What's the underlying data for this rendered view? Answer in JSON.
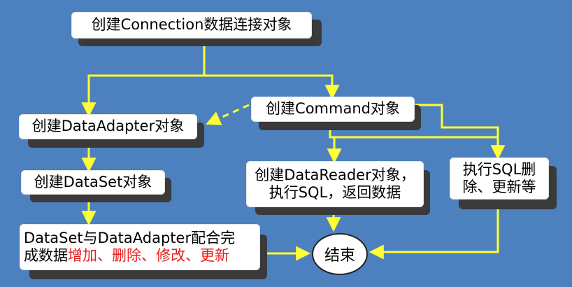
{
  "nodes": {
    "create_connection": "创建Connection数据连接对象",
    "create_command": "创建Command对象",
    "create_dataadapter": "创建DataAdapter对象",
    "create_dataset": "创建DataSet对象",
    "create_datareader_line1": "创建DataReader对象，",
    "create_datareader_line2": "执行SQL，返回数据",
    "exec_sql_line1": "执行SQL删",
    "exec_sql_line2": "除、更新等",
    "dataset_combine_line1": "DataSet与DataAdapter配合完",
    "dataset_combine_prefix": "成数据",
    "dataset_combine_ops": "增加、删除、修改、更新",
    "end": "结束"
  },
  "colors": {
    "background": "#4d80be",
    "arrow": "#ffff33",
    "highlight_text": "#e81d1d",
    "box": "#ffffff",
    "shadow": "#3a3a3a"
  }
}
